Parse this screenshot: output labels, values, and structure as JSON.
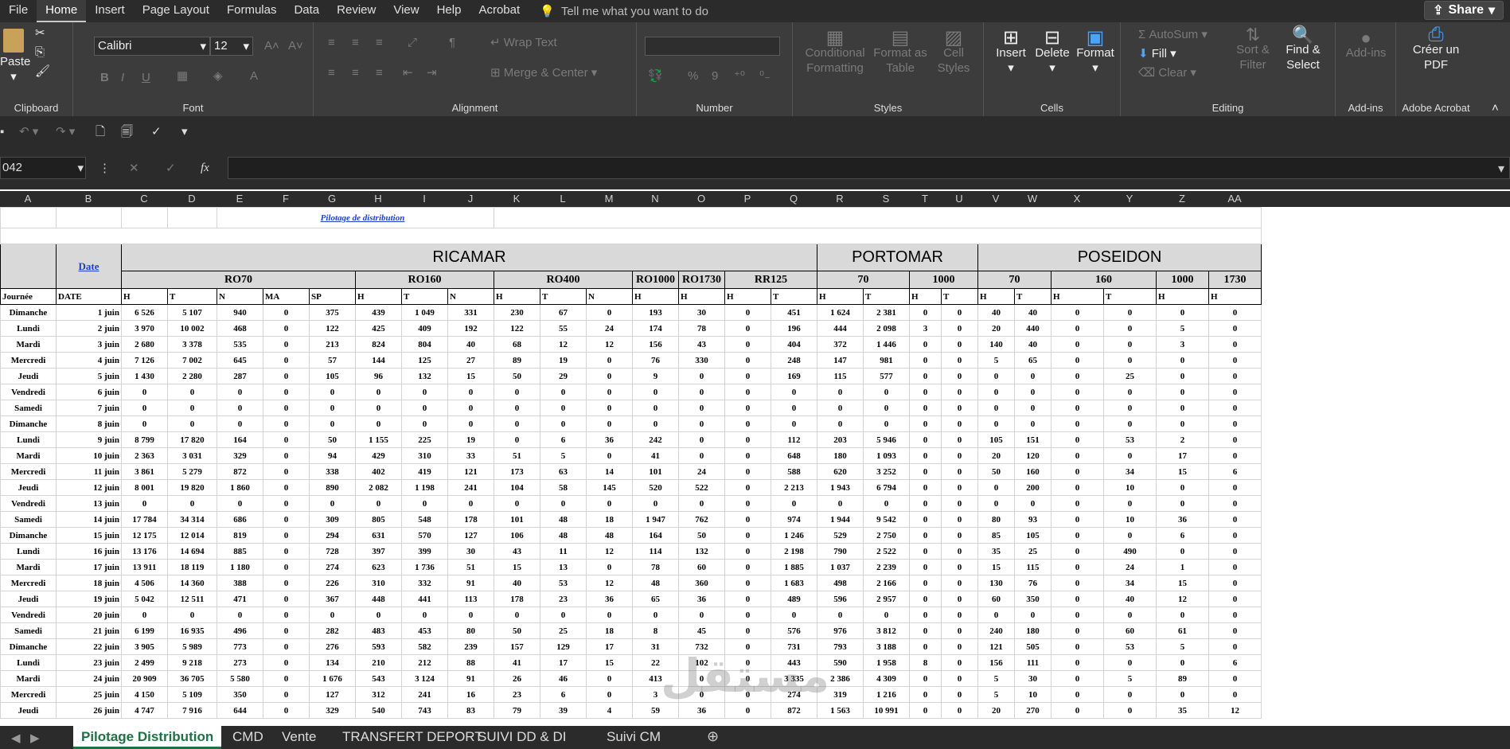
{
  "menu": {
    "items": [
      "File",
      "Home",
      "Insert",
      "Page Layout",
      "Formulas",
      "Data",
      "Review",
      "View",
      "Help",
      "Acrobat"
    ],
    "tell": "Tell me what you want to do",
    "share": "Share"
  },
  "ribbon": {
    "clipboard": {
      "label": "Clipboard",
      "paste": "Paste"
    },
    "font": {
      "label": "Font",
      "name": "Calibri",
      "size": "12",
      "b": "B",
      "i": "I",
      "u": "U"
    },
    "alignment": {
      "label": "Alignment",
      "wrap": "Wrap Text",
      "merge": "Merge & Center"
    },
    "number": {
      "label": "Number",
      "pct": "%",
      "comma": "9"
    },
    "styles": {
      "label": "Styles",
      "cond": "Conditional Formatting",
      "table": "Format as Table",
      "cell": "Cell Styles"
    },
    "cells": {
      "label": "Cells",
      "insert": "Insert",
      "delete": "Delete",
      "format": "Format"
    },
    "editing": {
      "label": "Editing",
      "autosum": "AutoSum",
      "fill": "Fill",
      "clear": "Clear",
      "sort": "Sort & Filter",
      "find": "Find & Select"
    },
    "addins": {
      "label": "Add-ins",
      "btn": "Add-ins"
    },
    "acrobat": {
      "label": "Adobe Acrobat",
      "btn": "Créer un PDF"
    }
  },
  "formula": {
    "namebox": "042",
    "fx": "fx"
  },
  "columns": [
    "A",
    "B",
    "C",
    "D",
    "E",
    "F",
    "G",
    "H",
    "I",
    "J",
    "K",
    "L",
    "M",
    "N",
    "O",
    "P",
    "Q",
    "R",
    "S",
    "T",
    "U",
    "V",
    "W",
    "X",
    "Y",
    "Z",
    "AA"
  ],
  "sheet": {
    "title": "Pilotage de distribution",
    "date_link": "Date",
    "groups": {
      "ricamar": "RICAMAR",
      "portomar": "PORTOMAR",
      "poseidon": "POSEIDON"
    },
    "products": [
      "RO70",
      "RO160",
      "RO400",
      "RO1000",
      "RO1730",
      "RR125",
      "70",
      "1000",
      "70",
      "160",
      "1000",
      "1730"
    ],
    "sub_left": [
      "Journée",
      "DATE"
    ],
    "subs": [
      "H",
      "T",
      "N",
      "MA",
      "SP",
      "H",
      "T",
      "N",
      "H",
      "T",
      "N",
      "H",
      "H",
      "H",
      "T",
      "H",
      "T",
      "H",
      "T",
      "H",
      "T",
      "H",
      "T",
      "H",
      "H"
    ],
    "rows": [
      [
        "Dimanche",
        "1 juin",
        "6 526",
        "5 107",
        "940",
        "0",
        "375",
        "439",
        "1 049",
        "331",
        "230",
        "67",
        "0",
        "193",
        "30",
        "0",
        "451",
        "1 624",
        "2 381",
        "0",
        "0",
        "40",
        "40",
        "0",
        "0",
        "0",
        "0"
      ],
      [
        "Lundi",
        "2 juin",
        "3 970",
        "10 002",
        "468",
        "0",
        "122",
        "425",
        "409",
        "192",
        "122",
        "55",
        "24",
        "174",
        "78",
        "0",
        "196",
        "444",
        "2 098",
        "3",
        "0",
        "20",
        "440",
        "0",
        "0",
        "5",
        "0"
      ],
      [
        "Mardi",
        "3 juin",
        "2 680",
        "3 378",
        "535",
        "0",
        "213",
        "824",
        "804",
        "40",
        "68",
        "12",
        "12",
        "156",
        "43",
        "0",
        "404",
        "372",
        "1 446",
        "0",
        "0",
        "140",
        "40",
        "0",
        "0",
        "3",
        "0"
      ],
      [
        "Mercredi",
        "4 juin",
        "7 126",
        "7 002",
        "645",
        "0",
        "57",
        "144",
        "125",
        "27",
        "89",
        "19",
        "0",
        "76",
        "330",
        "0",
        "248",
        "147",
        "981",
        "0",
        "0",
        "5",
        "65",
        "0",
        "0",
        "0",
        "0"
      ],
      [
        "Jeudi",
        "5 juin",
        "1 430",
        "2 280",
        "287",
        "0",
        "105",
        "96",
        "132",
        "15",
        "50",
        "29",
        "0",
        "9",
        "0",
        "0",
        "169",
        "115",
        "577",
        "0",
        "0",
        "0",
        "0",
        "0",
        "25",
        "0",
        "0"
      ],
      [
        "Vendredi",
        "6 juin",
        "0",
        "0",
        "0",
        "0",
        "0",
        "0",
        "0",
        "0",
        "0",
        "0",
        "0",
        "0",
        "0",
        "0",
        "0",
        "0",
        "0",
        "0",
        "0",
        "0",
        "0",
        "0",
        "0",
        "0",
        "0"
      ],
      [
        "Samedi",
        "7 juin",
        "0",
        "0",
        "0",
        "0",
        "0",
        "0",
        "0",
        "0",
        "0",
        "0",
        "0",
        "0",
        "0",
        "0",
        "0",
        "0",
        "0",
        "0",
        "0",
        "0",
        "0",
        "0",
        "0",
        "0",
        "0"
      ],
      [
        "Dimanche",
        "8 juin",
        "0",
        "0",
        "0",
        "0",
        "0",
        "0",
        "0",
        "0",
        "0",
        "0",
        "0",
        "0",
        "0",
        "0",
        "0",
        "0",
        "0",
        "0",
        "0",
        "0",
        "0",
        "0",
        "0",
        "0",
        "0"
      ],
      [
        "Lundi",
        "9 juin",
        "8 799",
        "17 820",
        "164",
        "0",
        "50",
        "1 155",
        "225",
        "19",
        "0",
        "6",
        "36",
        "242",
        "0",
        "0",
        "112",
        "203",
        "5 946",
        "0",
        "0",
        "105",
        "151",
        "0",
        "53",
        "2",
        "0"
      ],
      [
        "Mardi",
        "10 juin",
        "2 363",
        "3 031",
        "329",
        "0",
        "94",
        "429",
        "310",
        "33",
        "51",
        "5",
        "0",
        "41",
        "0",
        "0",
        "648",
        "180",
        "1 093",
        "0",
        "0",
        "20",
        "120",
        "0",
        "0",
        "17",
        "0"
      ],
      [
        "Mercredi",
        "11 juin",
        "3 861",
        "5 279",
        "872",
        "0",
        "338",
        "402",
        "419",
        "121",
        "173",
        "63",
        "14",
        "101",
        "24",
        "0",
        "588",
        "620",
        "3 252",
        "0",
        "0",
        "50",
        "160",
        "0",
        "34",
        "15",
        "6"
      ],
      [
        "Jeudi",
        "12 juin",
        "8 001",
        "19 820",
        "1 860",
        "0",
        "890",
        "2 082",
        "1 198",
        "241",
        "104",
        "58",
        "145",
        "520",
        "522",
        "0",
        "2 213",
        "1 943",
        "6 794",
        "0",
        "0",
        "0",
        "200",
        "0",
        "10",
        "0",
        "0"
      ],
      [
        "Vendredi",
        "13 juin",
        "0",
        "0",
        "0",
        "0",
        "0",
        "0",
        "0",
        "0",
        "0",
        "0",
        "0",
        "0",
        "0",
        "0",
        "0",
        "0",
        "0",
        "0",
        "0",
        "0",
        "0",
        "0",
        "0",
        "0",
        "0"
      ],
      [
        "Samedi",
        "14 juin",
        "17 784",
        "34 314",
        "686",
        "0",
        "309",
        "805",
        "548",
        "178",
        "101",
        "48",
        "18",
        "1 947",
        "762",
        "0",
        "974",
        "1 944",
        "9 542",
        "0",
        "0",
        "80",
        "93",
        "0",
        "10",
        "36",
        "0"
      ],
      [
        "Dimanche",
        "15 juin",
        "12 175",
        "12 014",
        "819",
        "0",
        "294",
        "631",
        "570",
        "127",
        "106",
        "48",
        "48",
        "164",
        "50",
        "0",
        "1 246",
        "529",
        "2 750",
        "0",
        "0",
        "85",
        "105",
        "0",
        "0",
        "6",
        "0"
      ],
      [
        "Lundi",
        "16 juin",
        "13 176",
        "14 694",
        "885",
        "0",
        "728",
        "397",
        "399",
        "30",
        "43",
        "11",
        "12",
        "114",
        "132",
        "0",
        "2 198",
        "790",
        "2 522",
        "0",
        "0",
        "35",
        "25",
        "0",
        "490",
        "0",
        "0"
      ],
      [
        "Mardi",
        "17 juin",
        "13 911",
        "18 119",
        "1 180",
        "0",
        "274",
        "623",
        "1 736",
        "51",
        "15",
        "13",
        "0",
        "78",
        "60",
        "0",
        "1 885",
        "1 037",
        "2 239",
        "0",
        "0",
        "15",
        "115",
        "0",
        "24",
        "1",
        "0"
      ],
      [
        "Mercredi",
        "18 juin",
        "4 506",
        "14 360",
        "388",
        "0",
        "226",
        "310",
        "332",
        "91",
        "40",
        "53",
        "12",
        "48",
        "360",
        "0",
        "1 683",
        "498",
        "2 166",
        "0",
        "0",
        "130",
        "76",
        "0",
        "34",
        "15",
        "0"
      ],
      [
        "Jeudi",
        "19 juin",
        "5 042",
        "12 511",
        "471",
        "0",
        "367",
        "448",
        "441",
        "113",
        "178",
        "23",
        "36",
        "65",
        "36",
        "0",
        "489",
        "596",
        "2 957",
        "0",
        "0",
        "60",
        "350",
        "0",
        "40",
        "12",
        "0"
      ],
      [
        "Vendredi",
        "20 juin",
        "0",
        "0",
        "0",
        "0",
        "0",
        "0",
        "0",
        "0",
        "0",
        "0",
        "0",
        "0",
        "0",
        "0",
        "0",
        "0",
        "0",
        "0",
        "0",
        "0",
        "0",
        "0",
        "0",
        "0",
        "0"
      ],
      [
        "Samedi",
        "21 juin",
        "6 199",
        "16 935",
        "496",
        "0",
        "282",
        "483",
        "453",
        "80",
        "50",
        "25",
        "18",
        "8",
        "45",
        "0",
        "576",
        "976",
        "3 812",
        "0",
        "0",
        "240",
        "180",
        "0",
        "60",
        "61",
        "0"
      ],
      [
        "Dimanche",
        "22 juin",
        "3 905",
        "5 989",
        "773",
        "0",
        "276",
        "593",
        "582",
        "239",
        "157",
        "129",
        "17",
        "31",
        "732",
        "0",
        "731",
        "793",
        "3 188",
        "0",
        "0",
        "121",
        "505",
        "0",
        "53",
        "5",
        "0"
      ],
      [
        "Lundi",
        "23 juin",
        "2 499",
        "9 218",
        "273",
        "0",
        "134",
        "210",
        "212",
        "88",
        "41",
        "17",
        "15",
        "22",
        "102",
        "0",
        "443",
        "590",
        "1 958",
        "8",
        "0",
        "156",
        "111",
        "0",
        "0",
        "0",
        "6"
      ],
      [
        "Mardi",
        "24 juin",
        "20 909",
        "36 705",
        "5 580",
        "0",
        "1 676",
        "543",
        "3 124",
        "91",
        "26",
        "46",
        "0",
        "413",
        "0",
        "0",
        "3 335",
        "2 386",
        "4 309",
        "0",
        "0",
        "5",
        "30",
        "0",
        "5",
        "89",
        "0"
      ],
      [
        "Mercredi",
        "25 juin",
        "4 150",
        "5 109",
        "350",
        "0",
        "127",
        "312",
        "241",
        "16",
        "23",
        "6",
        "0",
        "3",
        "0",
        "0",
        "274",
        "319",
        "1 216",
        "0",
        "0",
        "5",
        "10",
        "0",
        "0",
        "0",
        "0"
      ],
      [
        "Jeudi",
        "26 juin",
        "4 747",
        "7 916",
        "644",
        "0",
        "329",
        "540",
        "743",
        "83",
        "79",
        "39",
        "4",
        "59",
        "36",
        "0",
        "872",
        "1 563",
        "10 991",
        "0",
        "0",
        "20",
        "270",
        "0",
        "0",
        "35",
        "12"
      ]
    ]
  },
  "tabs": [
    "Pilotage Distribution",
    "CMD",
    "Vente",
    "TRANSFERT DEPORT",
    "SUIVI  DD & DI",
    "Suivi CM"
  ]
}
